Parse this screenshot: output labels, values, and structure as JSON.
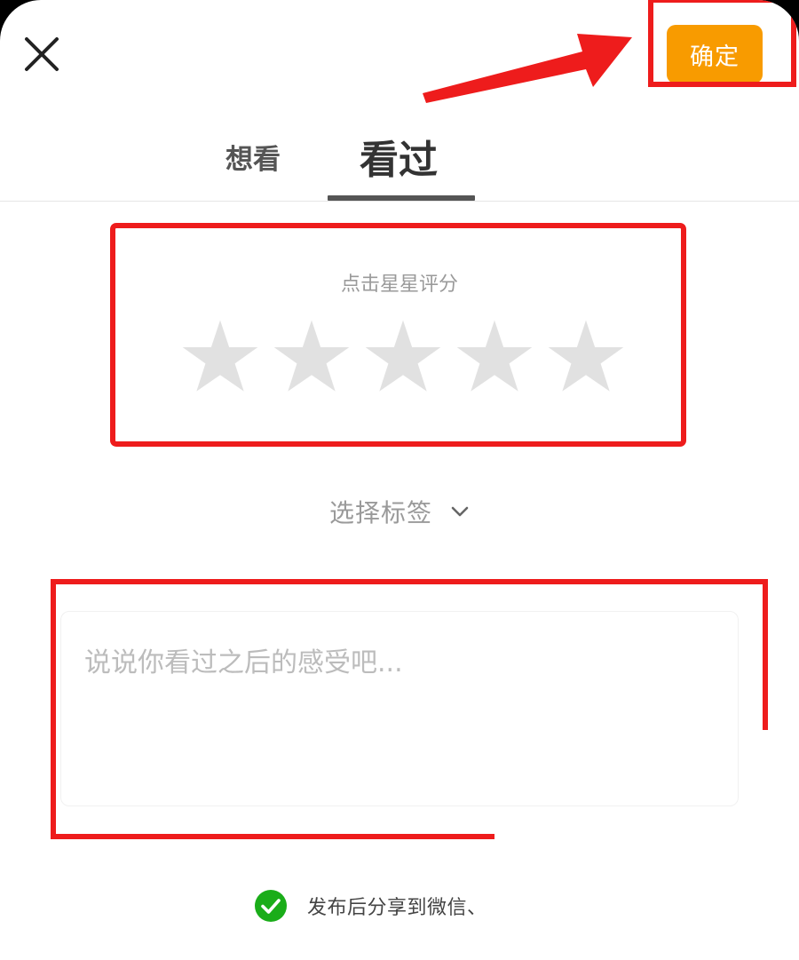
{
  "header": {
    "close_icon": "close-icon",
    "confirm_label": "确定",
    "accent_color": "#f89b00"
  },
  "tabs": [
    {
      "label": "想看",
      "active": false
    },
    {
      "label": "看过",
      "active": true
    }
  ],
  "rating": {
    "hint": "点击星星评分",
    "max_stars": 5,
    "value": 0,
    "star_color_empty": "#e1e1e1"
  },
  "tag_select": {
    "label": "选择标签",
    "icon": "chevron-down-icon"
  },
  "comment": {
    "placeholder": "说说你看过之后的感受吧...",
    "value": ""
  },
  "share": {
    "checked": true,
    "label": "发布后分享到微信、",
    "check_color": "#1aad19"
  },
  "annotation_color": "#ee1c1c"
}
